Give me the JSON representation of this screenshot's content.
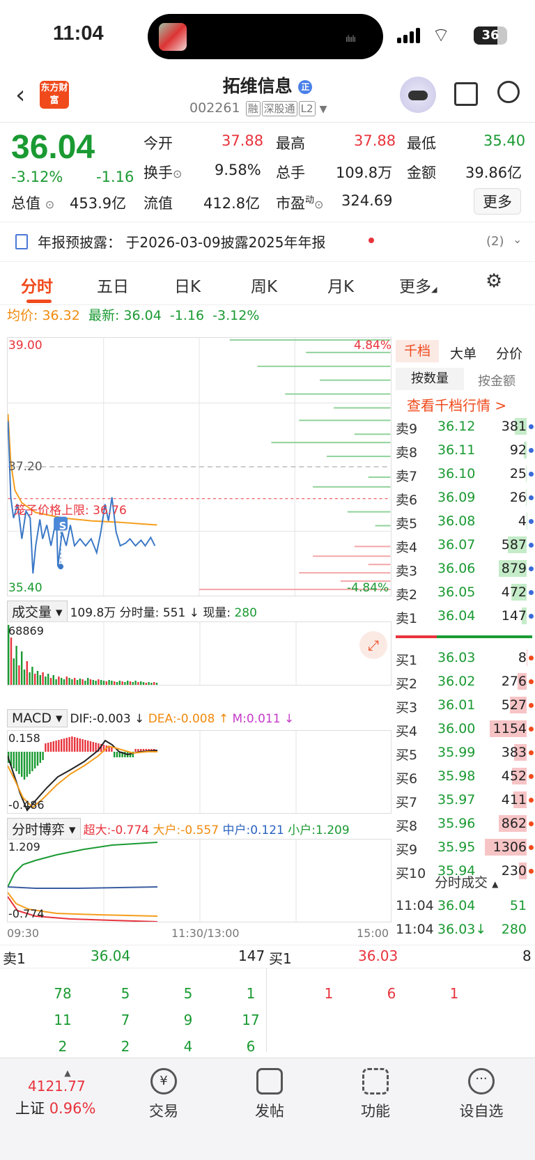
{
  "status": {
    "time": "11:04",
    "battery": "36"
  },
  "header": {
    "logo": "东方财富",
    "name": "拓维信息",
    "code": "002261",
    "tags": [
      "融",
      "深股通",
      "L2"
    ]
  },
  "quote": {
    "price": "36.04",
    "pct": "-3.12%",
    "chg": "-1.16",
    "labels": {
      "open": "今开",
      "high": "最高",
      "low": "最低",
      "turnover": "换手",
      "vol": "总手",
      "amount": "金额",
      "mcap": "总值",
      "float": "流值",
      "pe": "市盈"
    },
    "open": "37.88",
    "high": "37.88",
    "low": "35.40",
    "turnover": "9.58%",
    "vol": "109.8万",
    "amount": "39.86亿",
    "mcap": "453.9亿",
    "float": "412.8亿",
    "pe_sup": "动",
    "pe": "324.69",
    "more": "更多"
  },
  "notice": {
    "text": "年报预披露：  于2026-03-09披露2025年年报",
    "count": "(2)"
  },
  "tabs": [
    "分时",
    "五日",
    "日K",
    "周K",
    "月K",
    "更多"
  ],
  "avg": {
    "label": "均价:",
    "value": "36.32",
    "latest_label": "最新:",
    "latest": "36.04",
    "chg": "-1.16",
    "pct": "-3.12%"
  },
  "chart": {
    "top": "39.00",
    "mid": "37.20",
    "bottom": "35.40",
    "top_pct": "4.84%",
    "bot_pct": "-4.84%",
    "limit_label": "笼子价格上限:",
    "limit": "36.76",
    "marker": "S",
    "time_start": "09:30",
    "time_mid": "11:30/13:00",
    "time_end": "15:00"
  },
  "volume": {
    "select": "成交量",
    "total": "109.8万",
    "fs_label": "分时量:",
    "fs": "551",
    "now_label": "现量:",
    "now": "280",
    "max": "68869"
  },
  "macd": {
    "select": "MACD",
    "dif": "DIF:-0.003",
    "dea": "DEA:-0.008",
    "m": "M:0.011",
    "top": "0.158",
    "bottom": "-0.486"
  },
  "game": {
    "select": "分时博弈",
    "super": "超大:-0.774",
    "big": "大户:-0.557",
    "mid": "中户:0.121",
    "small": "小户:1.209",
    "top": "1.209",
    "bottom": "-0.774"
  },
  "book": {
    "tab1": "千档",
    "tab2": "大单",
    "tab3": "分价",
    "btn1": "按数量",
    "btn2": "按金额",
    "link": "查看千档行情 >",
    "sells": [
      [
        "卖9",
        "36.12",
        "381"
      ],
      [
        "卖8",
        "36.11",
        "92"
      ],
      [
        "卖7",
        "36.10",
        "25"
      ],
      [
        "卖6",
        "36.09",
        "26"
      ],
      [
        "卖5",
        "36.08",
        "4"
      ],
      [
        "卖4",
        "36.07",
        "587"
      ],
      [
        "卖3",
        "36.06",
        "879"
      ],
      [
        "卖2",
        "36.05",
        "472"
      ],
      [
        "卖1",
        "36.04",
        "147"
      ]
    ],
    "buys": [
      [
        "买1",
        "36.03",
        "8"
      ],
      [
        "买2",
        "36.02",
        "276"
      ],
      [
        "买3",
        "36.01",
        "527"
      ],
      [
        "买4",
        "36.00",
        "1154"
      ],
      [
        "买5",
        "35.99",
        "383"
      ],
      [
        "买6",
        "35.98",
        "452"
      ],
      [
        "买7",
        "35.97",
        "411"
      ],
      [
        "买8",
        "35.96",
        "862"
      ],
      [
        "买9",
        "35.95",
        "1306"
      ],
      [
        "买10",
        "35.94",
        "230"
      ]
    ],
    "trades_title": "分时成交",
    "trades": [
      [
        "11:04",
        "36.04",
        "51"
      ],
      [
        "11:04",
        "36.03↓",
        "280"
      ]
    ]
  },
  "queue": {
    "sell_label": "卖1",
    "sell_price": "36.04",
    "sell_vol": "147",
    "buy_label": "买1",
    "buy_price": "36.03",
    "buy_vol": "8",
    "sell_rows": [
      [
        "78",
        "5",
        "5",
        "1"
      ],
      [
        "11",
        "7",
        "9",
        "17"
      ],
      [
        "2",
        "2",
        "4",
        "6"
      ]
    ],
    "buy_rows": [
      [
        "1",
        "6",
        "1"
      ]
    ]
  },
  "nav": {
    "index": "4121.77",
    "index_name": "上证",
    "index_pct": "0.96%",
    "trade": "交易",
    "post": "发帖",
    "func": "功能",
    "watch": "设自选"
  }
}
